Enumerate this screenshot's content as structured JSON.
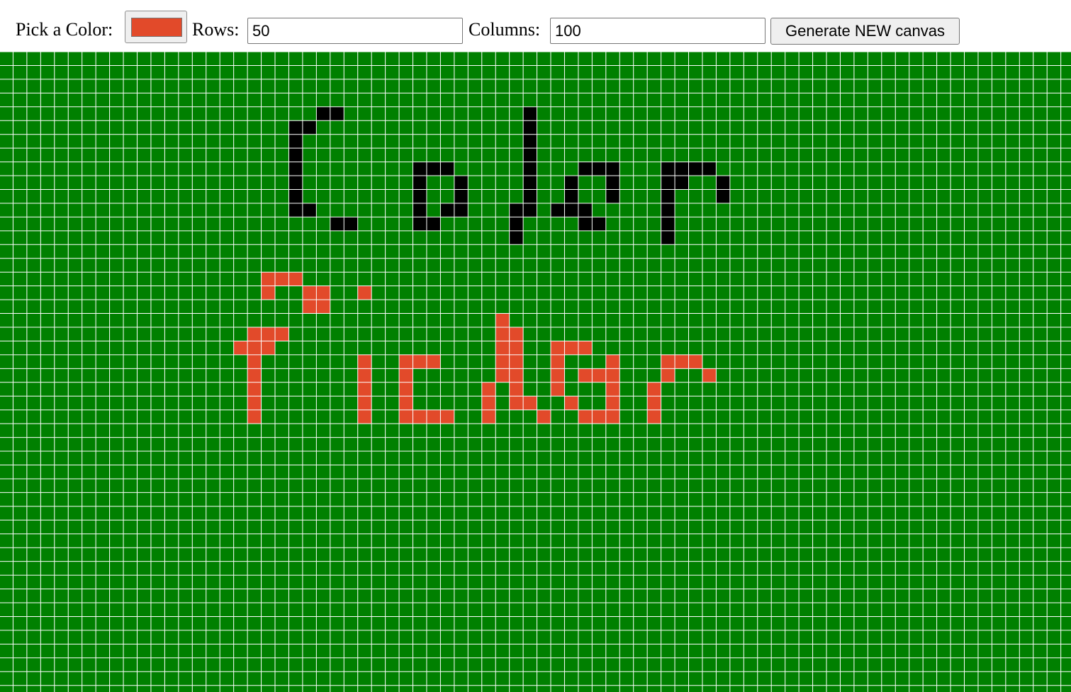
{
  "toolbar": {
    "color_label": "Pick a Color:",
    "selected_color": "#e24a2a",
    "rows_label": "Rows:",
    "rows_value": "50",
    "columns_label": "Columns:",
    "columns_value": "100",
    "generate_label": "Generate NEW canvas"
  },
  "canvas": {
    "background_color": "#008000",
    "grid_line_color": "#ffffff",
    "painted": [
      {
        "color": "#000000",
        "cells": [
          [
            23,
            4
          ],
          [
            24,
            4
          ],
          [
            38,
            4
          ],
          [
            21,
            5
          ],
          [
            22,
            5
          ],
          [
            38,
            5
          ],
          [
            21,
            6
          ],
          [
            38,
            6
          ],
          [
            21,
            7
          ],
          [
            38,
            7
          ],
          [
            21,
            8
          ],
          [
            30,
            8
          ],
          [
            31,
            8
          ],
          [
            32,
            8
          ],
          [
            38,
            8
          ],
          [
            42,
            8
          ],
          [
            43,
            8
          ],
          [
            44,
            8
          ],
          [
            48,
            8
          ],
          [
            49,
            8
          ],
          [
            50,
            8
          ],
          [
            51,
            8
          ],
          [
            21,
            9
          ],
          [
            30,
            9
          ],
          [
            33,
            9
          ],
          [
            38,
            9
          ],
          [
            41,
            9
          ],
          [
            44,
            9
          ],
          [
            48,
            9
          ],
          [
            49,
            9
          ],
          [
            52,
            9
          ],
          [
            21,
            10
          ],
          [
            30,
            10
          ],
          [
            33,
            10
          ],
          [
            38,
            10
          ],
          [
            41,
            10
          ],
          [
            44,
            10
          ],
          [
            48,
            10
          ],
          [
            52,
            10
          ],
          [
            21,
            11
          ],
          [
            22,
            11
          ],
          [
            30,
            11
          ],
          [
            32,
            11
          ],
          [
            33,
            11
          ],
          [
            37,
            11
          ],
          [
            38,
            11
          ],
          [
            40,
            11
          ],
          [
            41,
            11
          ],
          [
            42,
            11
          ],
          [
            48,
            11
          ],
          [
            24,
            12
          ],
          [
            25,
            12
          ],
          [
            30,
            12
          ],
          [
            31,
            12
          ],
          [
            37,
            12
          ],
          [
            42,
            12
          ],
          [
            43,
            12
          ],
          [
            48,
            12
          ],
          [
            37,
            13
          ],
          [
            48,
            13
          ]
        ]
      },
      {
        "color": "#e24a2a",
        "cells": [
          [
            19,
            16
          ],
          [
            20,
            16
          ],
          [
            21,
            16
          ],
          [
            19,
            17
          ],
          [
            22,
            17
          ],
          [
            23,
            17
          ],
          [
            26,
            17
          ],
          [
            22,
            18
          ],
          [
            23,
            18
          ],
          [
            36,
            19
          ],
          [
            18,
            20
          ],
          [
            19,
            20
          ],
          [
            20,
            20
          ],
          [
            36,
            20
          ],
          [
            37,
            20
          ],
          [
            17,
            21
          ],
          [
            18,
            21
          ],
          [
            19,
            21
          ],
          [
            36,
            21
          ],
          [
            37,
            21
          ],
          [
            40,
            21
          ],
          [
            41,
            21
          ],
          [
            42,
            21
          ],
          [
            18,
            22
          ],
          [
            26,
            22
          ],
          [
            29,
            22
          ],
          [
            30,
            22
          ],
          [
            31,
            22
          ],
          [
            36,
            22
          ],
          [
            37,
            22
          ],
          [
            40,
            22
          ],
          [
            44,
            22
          ],
          [
            48,
            22
          ],
          [
            49,
            22
          ],
          [
            50,
            22
          ],
          [
            18,
            23
          ],
          [
            26,
            23
          ],
          [
            29,
            23
          ],
          [
            36,
            23
          ],
          [
            37,
            23
          ],
          [
            40,
            23
          ],
          [
            42,
            23
          ],
          [
            43,
            23
          ],
          [
            44,
            23
          ],
          [
            48,
            23
          ],
          [
            51,
            23
          ],
          [
            18,
            24
          ],
          [
            26,
            24
          ],
          [
            29,
            24
          ],
          [
            35,
            24
          ],
          [
            37,
            24
          ],
          [
            40,
            24
          ],
          [
            44,
            24
          ],
          [
            47,
            24
          ],
          [
            18,
            25
          ],
          [
            26,
            25
          ],
          [
            29,
            25
          ],
          [
            35,
            25
          ],
          [
            37,
            25
          ],
          [
            38,
            25
          ],
          [
            41,
            25
          ],
          [
            44,
            25
          ],
          [
            47,
            25
          ],
          [
            18,
            26
          ],
          [
            26,
            26
          ],
          [
            29,
            26
          ],
          [
            30,
            26
          ],
          [
            31,
            26
          ],
          [
            32,
            26
          ],
          [
            35,
            26
          ],
          [
            39,
            26
          ],
          [
            42,
            26
          ],
          [
            43,
            26
          ],
          [
            44,
            26
          ],
          [
            47,
            26
          ]
        ]
      }
    ]
  }
}
